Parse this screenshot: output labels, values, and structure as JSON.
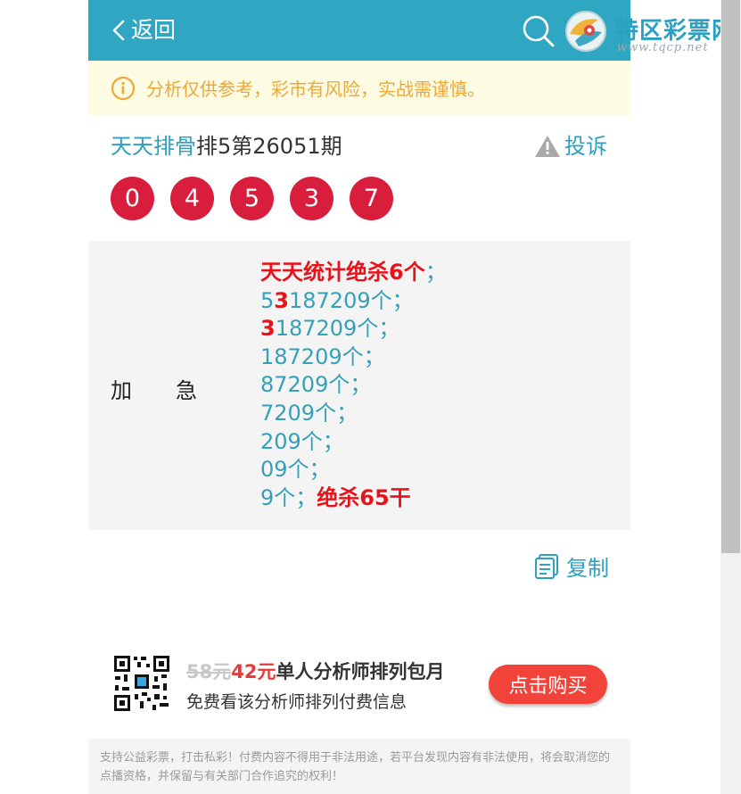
{
  "header": {
    "back_label": "返回",
    "brand_name": "特区彩票网",
    "brand_url": "www.tqcp.net"
  },
  "notice": {
    "text": "分析仅供参考，彩市有风险，实战需谨慎。"
  },
  "article": {
    "plan_name": "天天排骨",
    "issue": "排5第26051期",
    "complain_label": "投诉",
    "numbers": [
      "0",
      "4",
      "5",
      "3",
      "7"
    ]
  },
  "panel": {
    "label_left": "加",
    "label_right": "急",
    "line1_red": "天天统计绝杀6个",
    "semi": "；",
    "line2_a": "5",
    "line2_red": "3",
    "line2_b": "187209个；",
    "line3_red": "3",
    "line3_b": "187209个；",
    "line4": "187209个；",
    "line5": "87209个；",
    "line6": "7209个；",
    "line7": "209个；",
    "line8": "09个；",
    "line9_a": "9个；",
    "line9_red": "绝杀65干"
  },
  "actions": {
    "copy_label": "复制"
  },
  "promo": {
    "old_price": "58元",
    "new_price": "42元",
    "plan_name": "单人分析师排列包月",
    "subtitle": "免费看该分析师排列付费信息",
    "buy_label": "点击购买"
  },
  "footer": {
    "text": "支持公益彩票，打击私彩！付费内容不得用于非法用途，若平台发现内容有非法使用，将会取消您的点播资格，并保留与有关部门合作追究的权利！"
  },
  "colors": {
    "header_bg": "#2fa6c2",
    "ball_red": "#d81e3c",
    "accent_blue": "#2fa0bd",
    "buy_red": "#f2433a"
  }
}
